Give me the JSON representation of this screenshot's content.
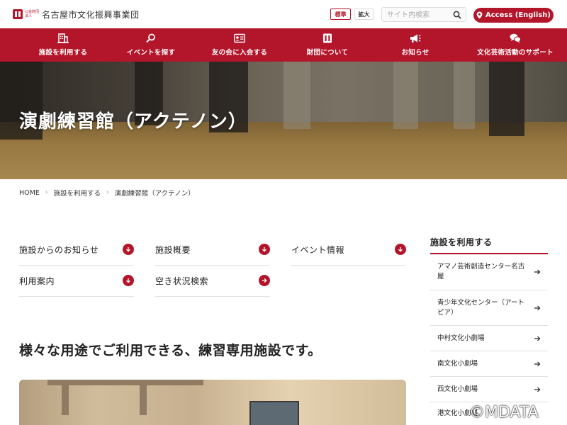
{
  "header": {
    "logo_sub": "公益財団法人",
    "logo_text": "名古屋市文化振興事業団",
    "size_standard": "標準",
    "size_large": "拡大",
    "search_placeholder": "サイト内検索",
    "access_label": "Access (English)"
  },
  "nav": {
    "items": [
      {
        "label": "施設を利用する",
        "icon": "building-icon"
      },
      {
        "label": "イベントを探す",
        "icon": "search-icon"
      },
      {
        "label": "友の会に入会する",
        "icon": "member-card-icon"
      },
      {
        "label": "財団について",
        "icon": "foundation-logo-icon"
      },
      {
        "label": "お知らせ",
        "icon": "megaphone-icon"
      },
      {
        "label": "文化芸術活動のサポート",
        "icon": "chat-bubbles-icon"
      }
    ]
  },
  "hero": {
    "title": "演劇練習館（アクテノン）"
  },
  "breadcrumb": {
    "home": "HOME",
    "level1": "施設を利用する",
    "current": "演劇練習館（アクテノン）"
  },
  "sections": [
    {
      "label": "施設からのお知らせ",
      "icon": "arrow-down-circle-icon"
    },
    {
      "label": "施設概要",
      "icon": "arrow-down-circle-icon"
    },
    {
      "label": "イベント情報",
      "icon": "arrow-down-circle-icon"
    },
    {
      "label": "利用案内",
      "icon": "arrow-down-circle-icon"
    },
    {
      "label": "空き状況検索",
      "icon": "arrow-right-circle-icon"
    }
  ],
  "headline": "様々な用途でご利用できる、練習専用施設です。",
  "sidebar": {
    "title": "施設を利用する",
    "items": [
      {
        "label": "アマノ芸術創造センター名古屋"
      },
      {
        "label": "青少年文化センター（アートピア）"
      },
      {
        "label": "中村文化小劇場"
      },
      {
        "label": "南文化小劇場"
      },
      {
        "label": "西文化小劇場"
      },
      {
        "label": "港文化小劇場"
      }
    ]
  },
  "watermark": "©MDATA",
  "colors": {
    "brand": "#b3162a"
  }
}
